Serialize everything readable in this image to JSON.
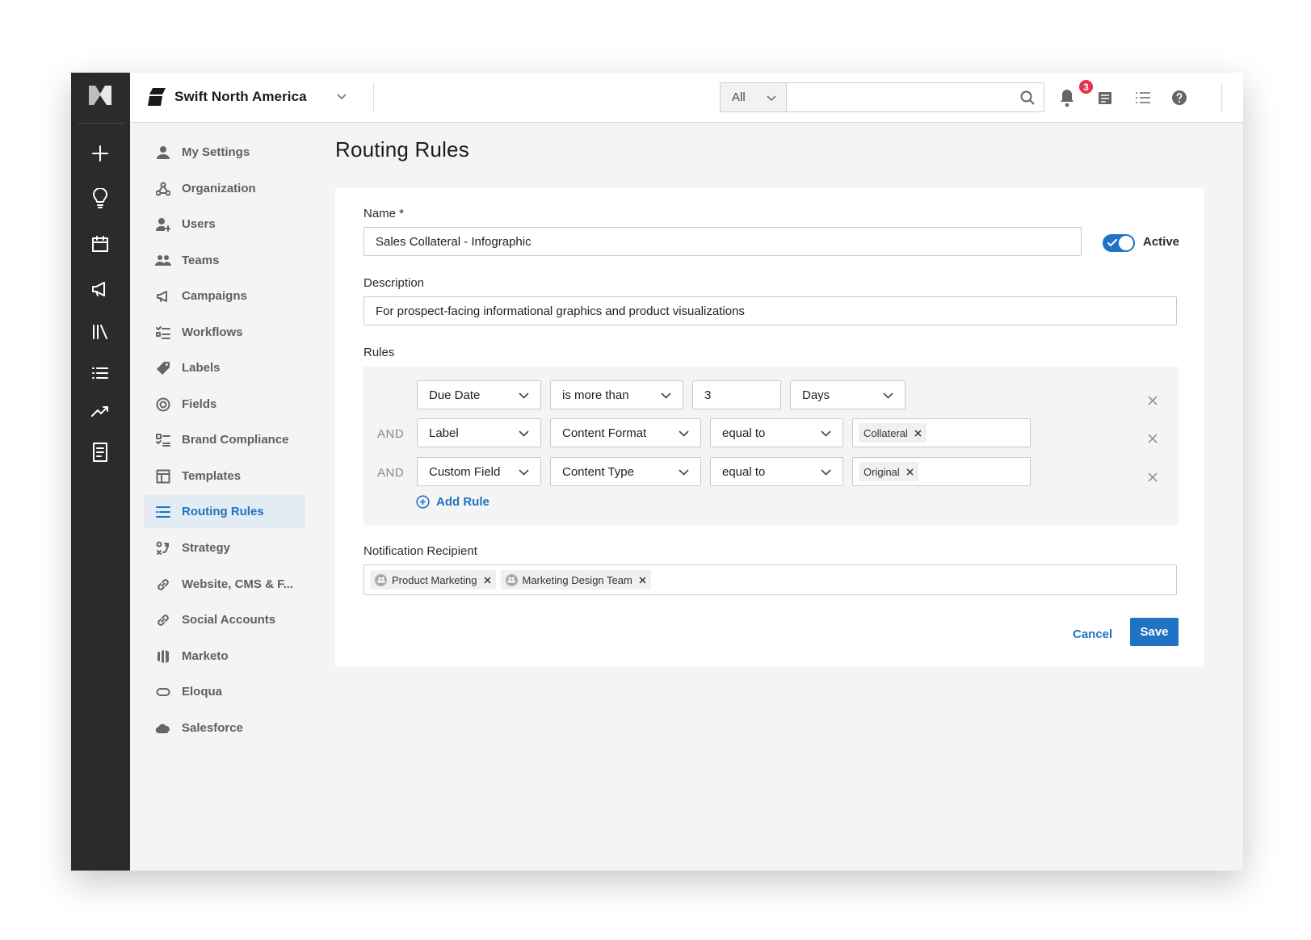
{
  "topbar": {
    "org_name": "Swift North America",
    "search_scope": "All",
    "search_placeholder": "",
    "notification_count": "3"
  },
  "rail": {
    "icons": [
      "logo-icon",
      "plus-icon",
      "lightbulb-icon",
      "calendar-icon",
      "megaphone-icon",
      "library-icon",
      "list-icon",
      "trend-icon",
      "document-icon"
    ]
  },
  "sidebar": {
    "items": [
      {
        "label": "My Settings",
        "icon": "person-icon"
      },
      {
        "label": "Organization",
        "icon": "organization-icon"
      },
      {
        "label": "Users",
        "icon": "user-add-icon"
      },
      {
        "label": "Teams",
        "icon": "team-icon"
      },
      {
        "label": "Campaigns",
        "icon": "megaphone-icon"
      },
      {
        "label": "Workflows",
        "icon": "workflow-icon"
      },
      {
        "label": "Labels",
        "icon": "tag-icon"
      },
      {
        "label": "Fields",
        "icon": "target-icon"
      },
      {
        "label": "Brand Compliance",
        "icon": "checklist-icon"
      },
      {
        "label": "Templates",
        "icon": "template-icon"
      },
      {
        "label": "Routing Rules",
        "icon": "routing-icon"
      },
      {
        "label": "Strategy",
        "icon": "strategy-icon"
      },
      {
        "label": "Website, CMS & F...",
        "icon": "link-icon"
      },
      {
        "label": "Social Accounts",
        "icon": "link-icon"
      },
      {
        "label": "Marketo",
        "icon": "marketo-icon"
      },
      {
        "label": "Eloqua",
        "icon": "eloqua-icon"
      },
      {
        "label": "Salesforce",
        "icon": "cloud-icon"
      }
    ],
    "active_index": 10
  },
  "page": {
    "title": "Routing Rules"
  },
  "form": {
    "name_label": "Name *",
    "name_value": "Sales Collateral - Infographic",
    "active_label": "Active",
    "active_on": true,
    "description_label": "Description",
    "description_value": "For prospect-facing informational graphics and product visualizations",
    "rules_label": "Rules",
    "rules": [
      {
        "conjunction": "",
        "field": "Due Date",
        "operator": "is more than",
        "value": "3",
        "unit": "Days"
      },
      {
        "conjunction": "AND",
        "field": "Label",
        "subfield": "Content Format",
        "operator": "equal to",
        "tags": [
          "Collateral"
        ]
      },
      {
        "conjunction": "AND",
        "field": "Custom Field",
        "subfield": "Content Type",
        "operator": "equal to",
        "tags": [
          "Original"
        ]
      }
    ],
    "add_rule_label": "Add Rule",
    "recipient_label": "Notification Recipient",
    "recipients": [
      "Product Marketing",
      "Marketing Design Team"
    ],
    "cancel_label": "Cancel",
    "save_label": "Save"
  },
  "colors": {
    "accent": "#1f72c4",
    "rail": "#2b2b2b",
    "badge": "#e5304e",
    "active_nav_bg": "#e3ebf3"
  }
}
